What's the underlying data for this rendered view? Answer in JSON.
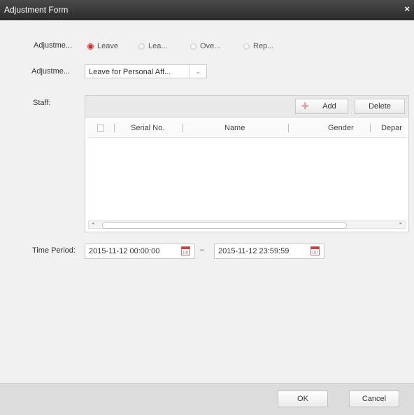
{
  "window": {
    "title": "Adjustment Form",
    "close_glyph": "×"
  },
  "adjustment_type": {
    "label": "Adjustme...",
    "options": [
      {
        "label": "Leave",
        "selected": true
      },
      {
        "label": "Lea...",
        "selected": false
      },
      {
        "label": "Ove...",
        "selected": false
      },
      {
        "label": "Rep...",
        "selected": false
      }
    ]
  },
  "adjustment_reason": {
    "label": "Adjustme...",
    "value": "Leave for Personal Aff...",
    "arrow": "⌄"
  },
  "staff": {
    "label": "Staff:",
    "add_label": "Add",
    "delete_label": "Delete",
    "columns": [
      "Serial No.",
      "Name",
      "Gender",
      "Depar"
    ],
    "rows": []
  },
  "time_period": {
    "label": "Time Period:",
    "start": "2015-11-12 00:00:00",
    "separator": "–",
    "end": "2015-11-12 23:59:59"
  },
  "footer": {
    "ok_label": "OK",
    "cancel_label": "Cancel"
  },
  "icons": {
    "add": "plus-icon",
    "calendar": "calendar-icon",
    "dropdown": "chevron-down-icon",
    "close": "close-icon"
  }
}
